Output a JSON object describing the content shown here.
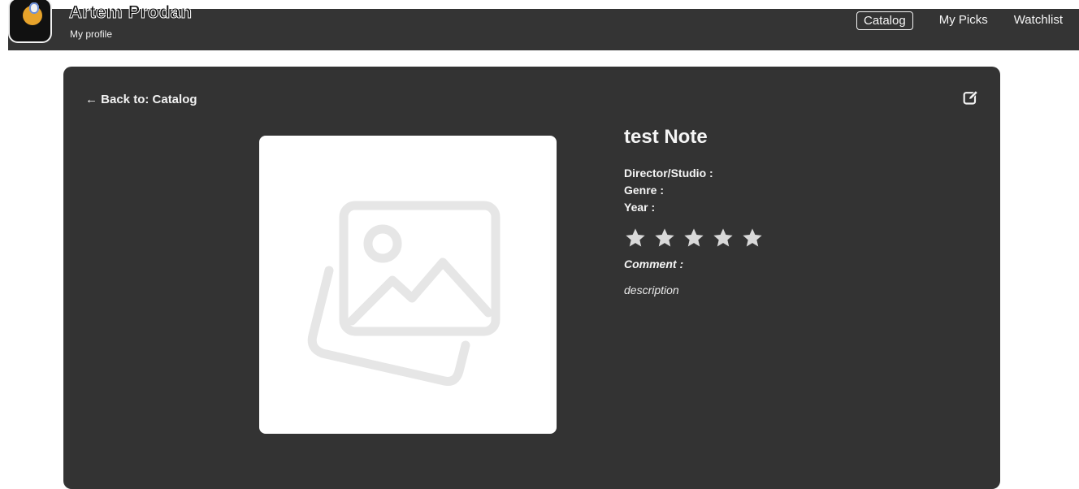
{
  "header": {
    "user_name": "Artem Prodan",
    "subtitle": "My profile",
    "nav": [
      {
        "label": "Catalog",
        "active": true
      },
      {
        "label": "My Picks",
        "active": false
      },
      {
        "label": "Watchlist",
        "active": false
      }
    ]
  },
  "detail": {
    "back_link": "← Back to: Catalog",
    "title": "test Note",
    "director_label": "Director/Studio :",
    "genre_label": "Genre :",
    "year_label": "Year :",
    "rating": {
      "value": 0,
      "max": 5
    },
    "comment_label": "Comment :",
    "comment_text": "description",
    "edit_icon": "edit-icon",
    "placeholder_icon": "image-placeholder-icon"
  },
  "colors": {
    "header_bg": "#343434",
    "card_bg": "#333333",
    "star_color": "#d9d9d9",
    "placeholder_icon": "#e6e6e6"
  }
}
